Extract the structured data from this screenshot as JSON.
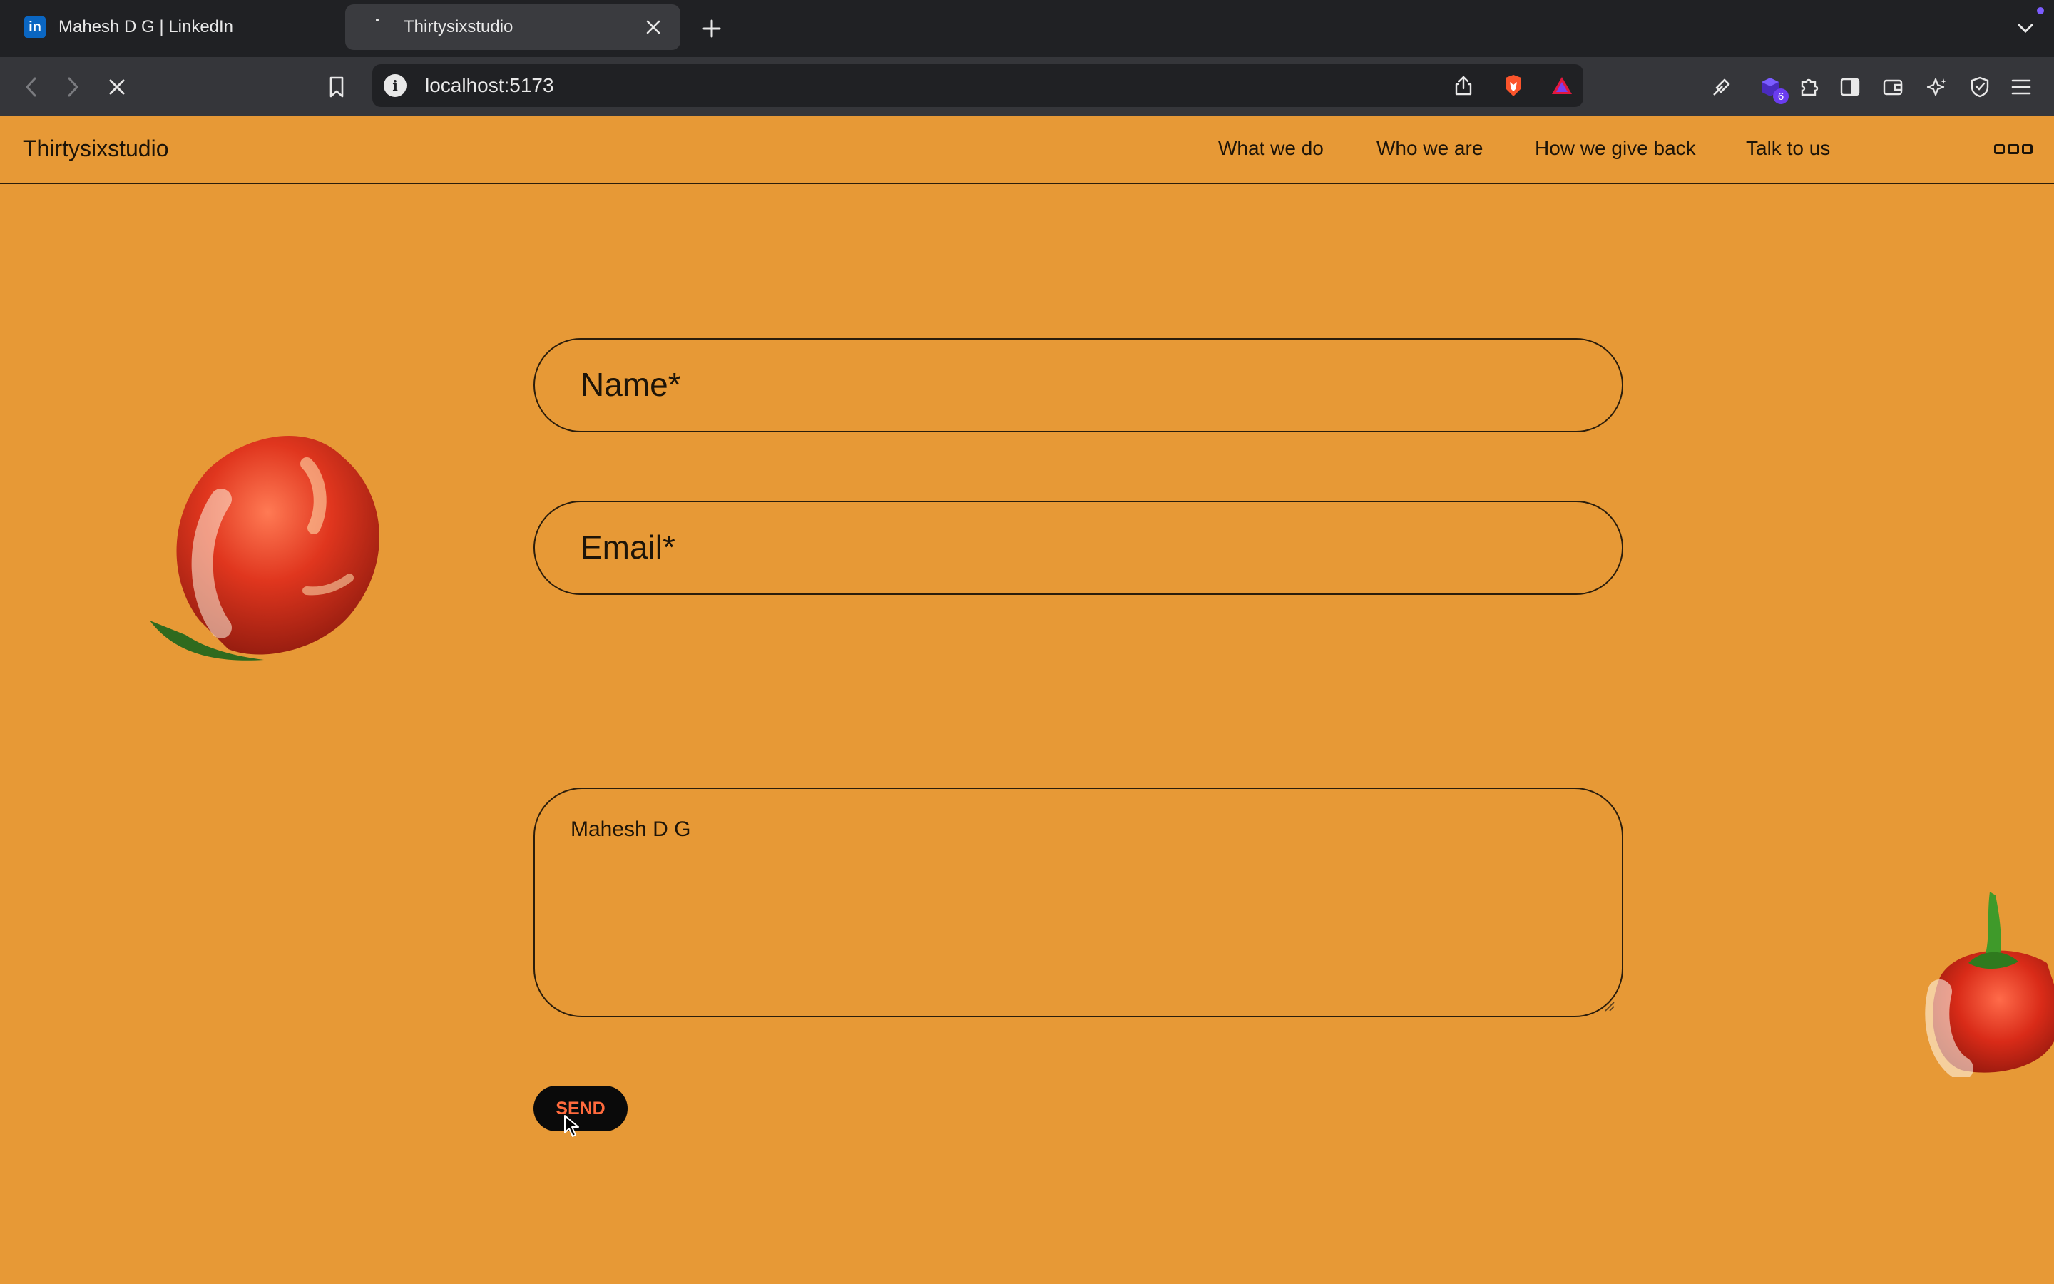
{
  "browser": {
    "tabs": [
      {
        "label": "Mahesh D G | LinkedIn",
        "icon": "linkedin-icon",
        "active": false
      },
      {
        "label": "Thirtysixstudio",
        "icon": "loading-spinner-icon",
        "active": true
      }
    ],
    "linkedin_glyph": "in",
    "url": "localhost:5173",
    "extension_badge": "6",
    "accent_color": "#7c5cff"
  },
  "site": {
    "brand": "Thirtysixstudio",
    "nav": [
      "What we do",
      "Who we are",
      "How we give back",
      "Talk to us"
    ],
    "background_color": "#e79936"
  },
  "form": {
    "name_placeholder": "Name*",
    "email_placeholder": "Email*",
    "message_value": "Mahesh D G",
    "send_label": "SEND",
    "send_text_color": "#ff6a3d"
  }
}
